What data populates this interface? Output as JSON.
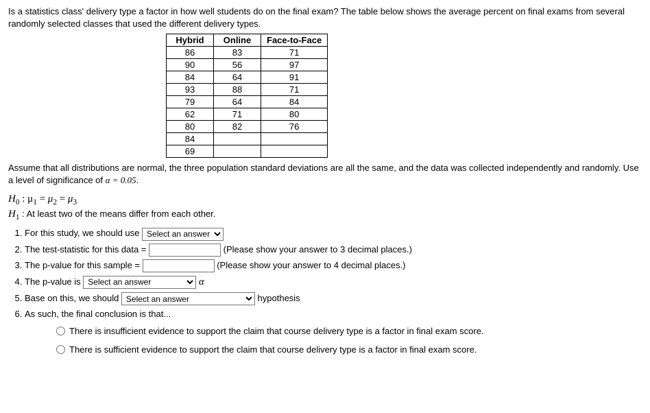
{
  "intro": "Is a statistics class' delivery type a factor in how well students do on the final exam? The table below shows the average percent on final exams from several randomly selected classes that used the different delivery types.",
  "table": {
    "headers": [
      "Hybrid",
      "Online",
      "Face-to-Face"
    ],
    "rows": [
      [
        "86",
        "83",
        "71"
      ],
      [
        "90",
        "56",
        "97"
      ],
      [
        "84",
        "64",
        "91"
      ],
      [
        "93",
        "88",
        "71"
      ],
      [
        "79",
        "64",
        "84"
      ],
      [
        "62",
        "71",
        "80"
      ],
      [
        "80",
        "82",
        "76"
      ],
      [
        "84",
        "",
        ""
      ],
      [
        "69",
        "",
        ""
      ]
    ]
  },
  "assume_pre": "Assume that all distributions are normal, the three population standard deviations are all the same, and the data was collected independently and randomly. Use a level of significance of ",
  "alpha_expr": "α = 0.05",
  "assume_post": ".",
  "h0_label": "H",
  "h0_sub": "0",
  "h0_body": " :  μ",
  "mu1_sub": "1",
  "eq": " = ",
  "mu2_sub": "2",
  "mu3_sub": "3",
  "h1_label": "H",
  "h1_sub": "1",
  "h1_body": " : At least two of the means differ from each other.",
  "q1_pre": "For this study, we should use ",
  "q1_select": "Select an answer",
  "q2_pre": "The test-statistic for this data = ",
  "q2_post": " (Please show your answer to 3 decimal places.)",
  "q3_pre": "The p-value for this sample = ",
  "q3_post": " (Please show your answer to 4 decimal places.)",
  "q4_pre": "The p-value is ",
  "q4_select": "Select an answer",
  "q4_post_sym": "α",
  "q5_pre": "Base on this, we should ",
  "q5_select": "Select an answer",
  "q5_post": " hypothesis",
  "q6": "As such, the final conclusion is that...",
  "opt_a": "There is insufficient evidence to support the claim that course delivery type is a factor in final exam score.",
  "opt_b": "There is sufficient evidence to support the claim that course delivery type is a factor in final exam score."
}
